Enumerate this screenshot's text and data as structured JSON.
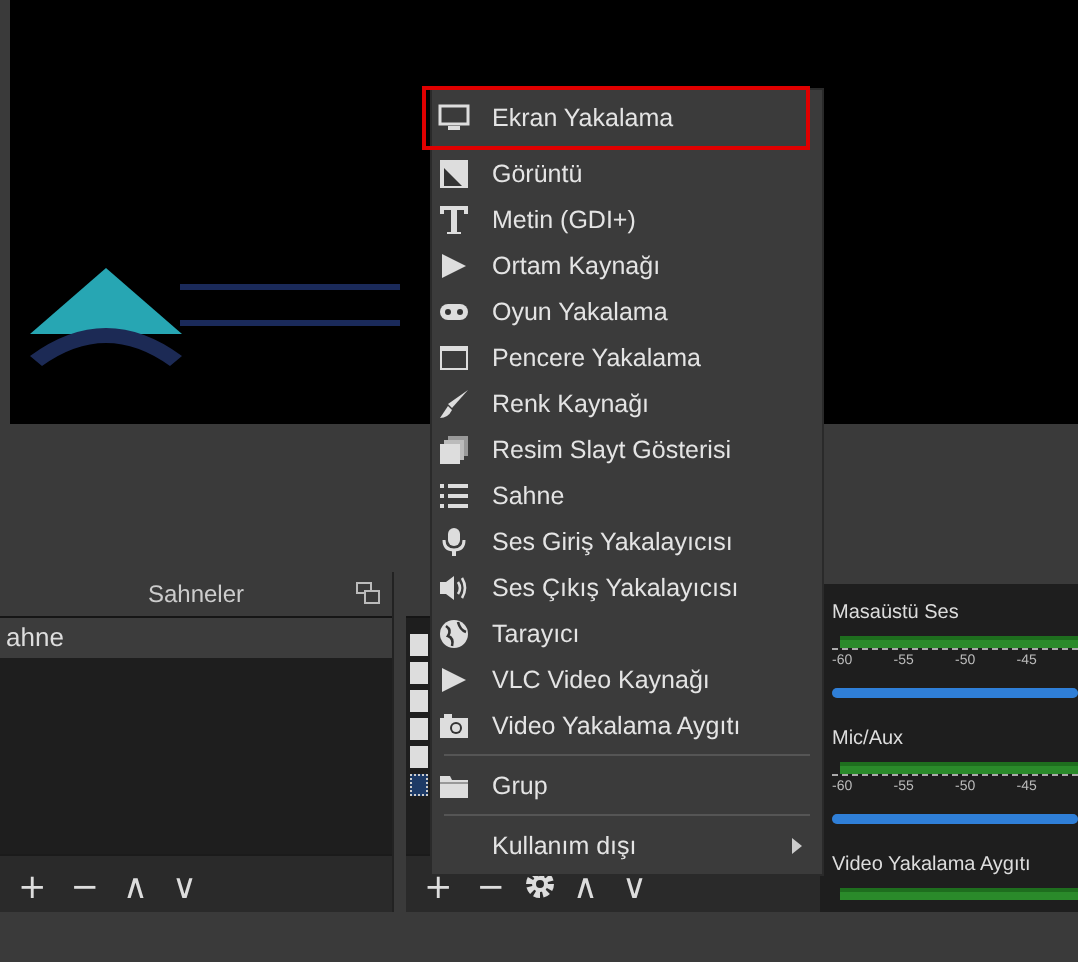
{
  "scenes_dock": {
    "title": "Sahneler",
    "scenes": [
      {
        "name": "ahne",
        "selected": true
      }
    ],
    "toolbar": [
      "+",
      "−",
      "∧",
      "∨"
    ]
  },
  "sources_dock": {
    "sources": [
      {
        "selected": false
      },
      {
        "selected": false
      },
      {
        "selected": false
      },
      {
        "selected": false
      },
      {
        "selected": false
      },
      {
        "selected": true
      }
    ],
    "toolbar": [
      "+",
      "−",
      "∧",
      "∨"
    ]
  },
  "mixer": {
    "channels": [
      {
        "name": "Masaüstü Ses",
        "ticks": [
          "-60",
          "-55",
          "-50",
          "-45"
        ],
        "level": 1
      },
      {
        "name": "Mic/Aux",
        "ticks": [
          "-60",
          "-55",
          "-50",
          "-45"
        ],
        "level": 1
      },
      {
        "name": "Video Yakalama Aygıtı"
      }
    ]
  },
  "context_menu": {
    "groups": [
      [
        {
          "label": "Ekran Yakalama",
          "annotated": true,
          "has_submenu": false
        },
        {
          "label": "Görüntü",
          "annotated": false,
          "has_submenu": false
        },
        {
          "label": "Metin (GDI+)",
          "annotated": false,
          "has_submenu": false
        },
        {
          "label": "Ortam Kaynağı",
          "annotated": false,
          "has_submenu": false
        },
        {
          "label": "Oyun Yakalama",
          "annotated": false,
          "has_submenu": false
        },
        {
          "label": "Pencere Yakalama",
          "annotated": false,
          "has_submenu": false
        },
        {
          "label": "Renk Kaynağı",
          "annotated": false,
          "has_submenu": false
        },
        {
          "label": "Resim Slayt Gösterisi",
          "annotated": false,
          "has_submenu": false
        },
        {
          "label": "Sahne",
          "annotated": false,
          "has_submenu": false
        },
        {
          "label": "Ses Giriş Yakalayıcısı",
          "annotated": false,
          "has_submenu": false
        },
        {
          "label": "Ses Çıkış Yakalayıcısı",
          "annotated": false,
          "has_submenu": false
        },
        {
          "label": "Tarayıcı",
          "annotated": false,
          "has_submenu": false
        },
        {
          "label": "VLC Video Kaynağı",
          "annotated": false,
          "has_submenu": false
        },
        {
          "label": "Video Yakalama Aygıtı",
          "annotated": false,
          "has_submenu": false
        }
      ],
      [
        {
          "label": "Grup",
          "annotated": false,
          "has_submenu": false
        }
      ],
      [
        {
          "label": "Kullanım dışı",
          "annotated": false,
          "has_submenu": true
        }
      ]
    ]
  }
}
